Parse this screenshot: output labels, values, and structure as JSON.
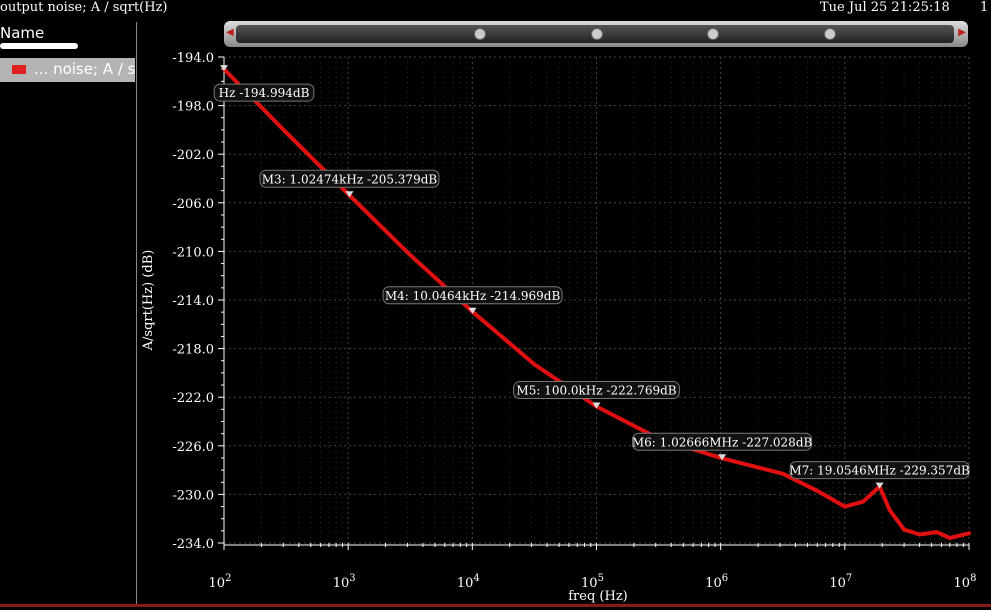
{
  "window": {
    "title": "output noise; A / sqrt(Hz)",
    "datetime": "Tue Jul 25 21:25:18",
    "page": "1"
  },
  "legend_panel": {
    "header": "Name",
    "entry": "... noise; A / sq"
  },
  "colors": {
    "trace": "#e01010",
    "grid": "#444444",
    "background": "#000000"
  },
  "chart_data": {
    "type": "line",
    "xscale": "log",
    "xlabel": "freq (Hz)",
    "ylabel": "A/sqrt(Hz) (dB)",
    "xlim": [
      100,
      100000000
    ],
    "ylim": [
      -234.0,
      -194.0
    ],
    "yticks": [
      "-194.0",
      "-198.0",
      "-202.0",
      "-206.0",
      "-210.0",
      "-214.0",
      "-218.0",
      "-222.0",
      "-226.0",
      "-230.0",
      "-234.0"
    ],
    "xticks": [
      {
        "base": "10",
        "exp": "2"
      },
      {
        "base": "10",
        "exp": "3"
      },
      {
        "base": "10",
        "exp": "4"
      },
      {
        "base": "10",
        "exp": "5"
      },
      {
        "base": "10",
        "exp": "6"
      },
      {
        "base": "10",
        "exp": "7"
      },
      {
        "base": "10",
        "exp": "8"
      }
    ],
    "series": [
      {
        "x": [
          100,
          316,
          1024.74,
          3162,
          10046.4,
          31620,
          100000,
          316200,
          1026660,
          3162000,
          6000000,
          10000000,
          14000000,
          19054600,
          23000000,
          30000000,
          40000000,
          55000000,
          70000000,
          100000000
        ],
        "y": [
          -194.994,
          -200.2,
          -205.379,
          -210.3,
          -214.969,
          -219.3,
          -222.769,
          -225.4,
          -227.028,
          -228.3,
          -229.7,
          -231.0,
          -230.6,
          -229.357,
          -231.3,
          -232.9,
          -233.3,
          -233.1,
          -233.6,
          -233.2
        ]
      }
    ],
    "markers": [
      {
        "label": "Hz -194.994dB",
        "x": 100,
        "y": -194.994
      },
      {
        "label": "M3: 1.02474kHz -205.379dB",
        "x": 1024.74,
        "y": -205.379
      },
      {
        "label": "M4: 10.0464kHz -214.969dB",
        "x": 10046.4,
        "y": -214.969
      },
      {
        "label": "M5: 100.0kHz -222.769dB",
        "x": 100000,
        "y": -222.769
      },
      {
        "label": "M6: 1.02666MHz -227.028dB",
        "x": 1026660,
        "y": -227.028
      },
      {
        "label": "M7: 19.0546MHz -229.357dB",
        "x": 19054600,
        "y": -229.357
      }
    ]
  }
}
